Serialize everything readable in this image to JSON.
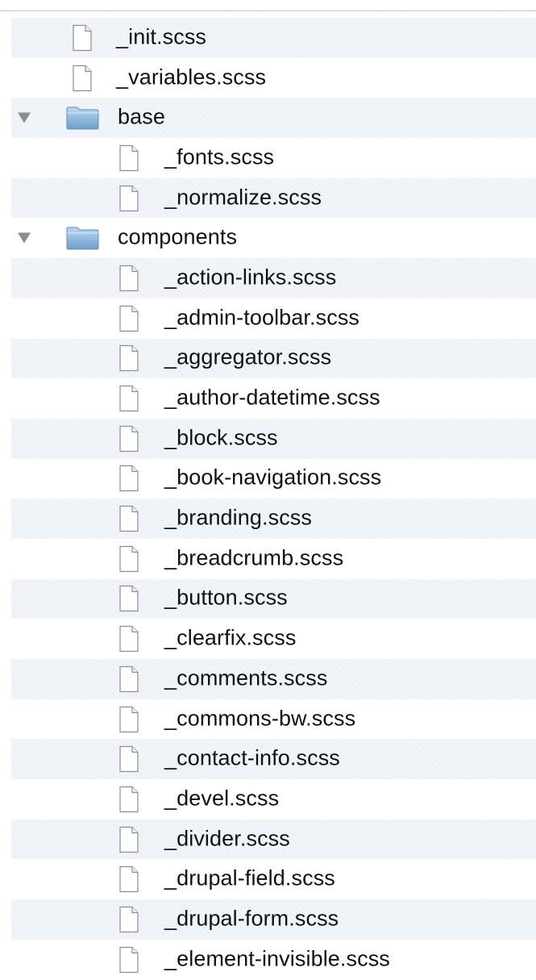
{
  "file_tree": {
    "items": [
      {
        "label": "_init.scss",
        "kind": "file",
        "depth": 1
      },
      {
        "label": "_variables.scss",
        "kind": "file",
        "depth": 1
      },
      {
        "label": "base",
        "kind": "folder",
        "depth": 0,
        "expanded": true
      },
      {
        "label": "_fonts.scss",
        "kind": "file",
        "depth": 2
      },
      {
        "label": "_normalize.scss",
        "kind": "file",
        "depth": 2
      },
      {
        "label": "components",
        "kind": "folder",
        "depth": 0,
        "expanded": true
      },
      {
        "label": "_action-links.scss",
        "kind": "file",
        "depth": 2
      },
      {
        "label": "_admin-toolbar.scss",
        "kind": "file",
        "depth": 2
      },
      {
        "label": "_aggregator.scss",
        "kind": "file",
        "depth": 2
      },
      {
        "label": "_author-datetime.scss",
        "kind": "file",
        "depth": 2
      },
      {
        "label": "_block.scss",
        "kind": "file",
        "depth": 2
      },
      {
        "label": "_book-navigation.scss",
        "kind": "file",
        "depth": 2
      },
      {
        "label": "_branding.scss",
        "kind": "file",
        "depth": 2
      },
      {
        "label": "_breadcrumb.scss",
        "kind": "file",
        "depth": 2
      },
      {
        "label": "_button.scss",
        "kind": "file",
        "depth": 2
      },
      {
        "label": "_clearfix.scss",
        "kind": "file",
        "depth": 2
      },
      {
        "label": "_comments.scss",
        "kind": "file",
        "depth": 2
      },
      {
        "label": "_commons-bw.scss",
        "kind": "file",
        "depth": 2
      },
      {
        "label": "_contact-info.scss",
        "kind": "file",
        "depth": 2
      },
      {
        "label": "_devel.scss",
        "kind": "file",
        "depth": 2
      },
      {
        "label": "_divider.scss",
        "kind": "file",
        "depth": 2
      },
      {
        "label": "_drupal-field.scss",
        "kind": "file",
        "depth": 2
      },
      {
        "label": "_drupal-form.scss",
        "kind": "file",
        "depth": 2
      },
      {
        "label": "_element-invisible.scss",
        "kind": "file",
        "depth": 2
      }
    ]
  },
  "colors": {
    "stripe": "#edf2f8",
    "text": "#111111",
    "folder_blue": "#7fb0d8"
  },
  "icons": {
    "file": "file-icon",
    "folder": "folder-icon",
    "disclosure": "disclosure-triangle-icon"
  }
}
